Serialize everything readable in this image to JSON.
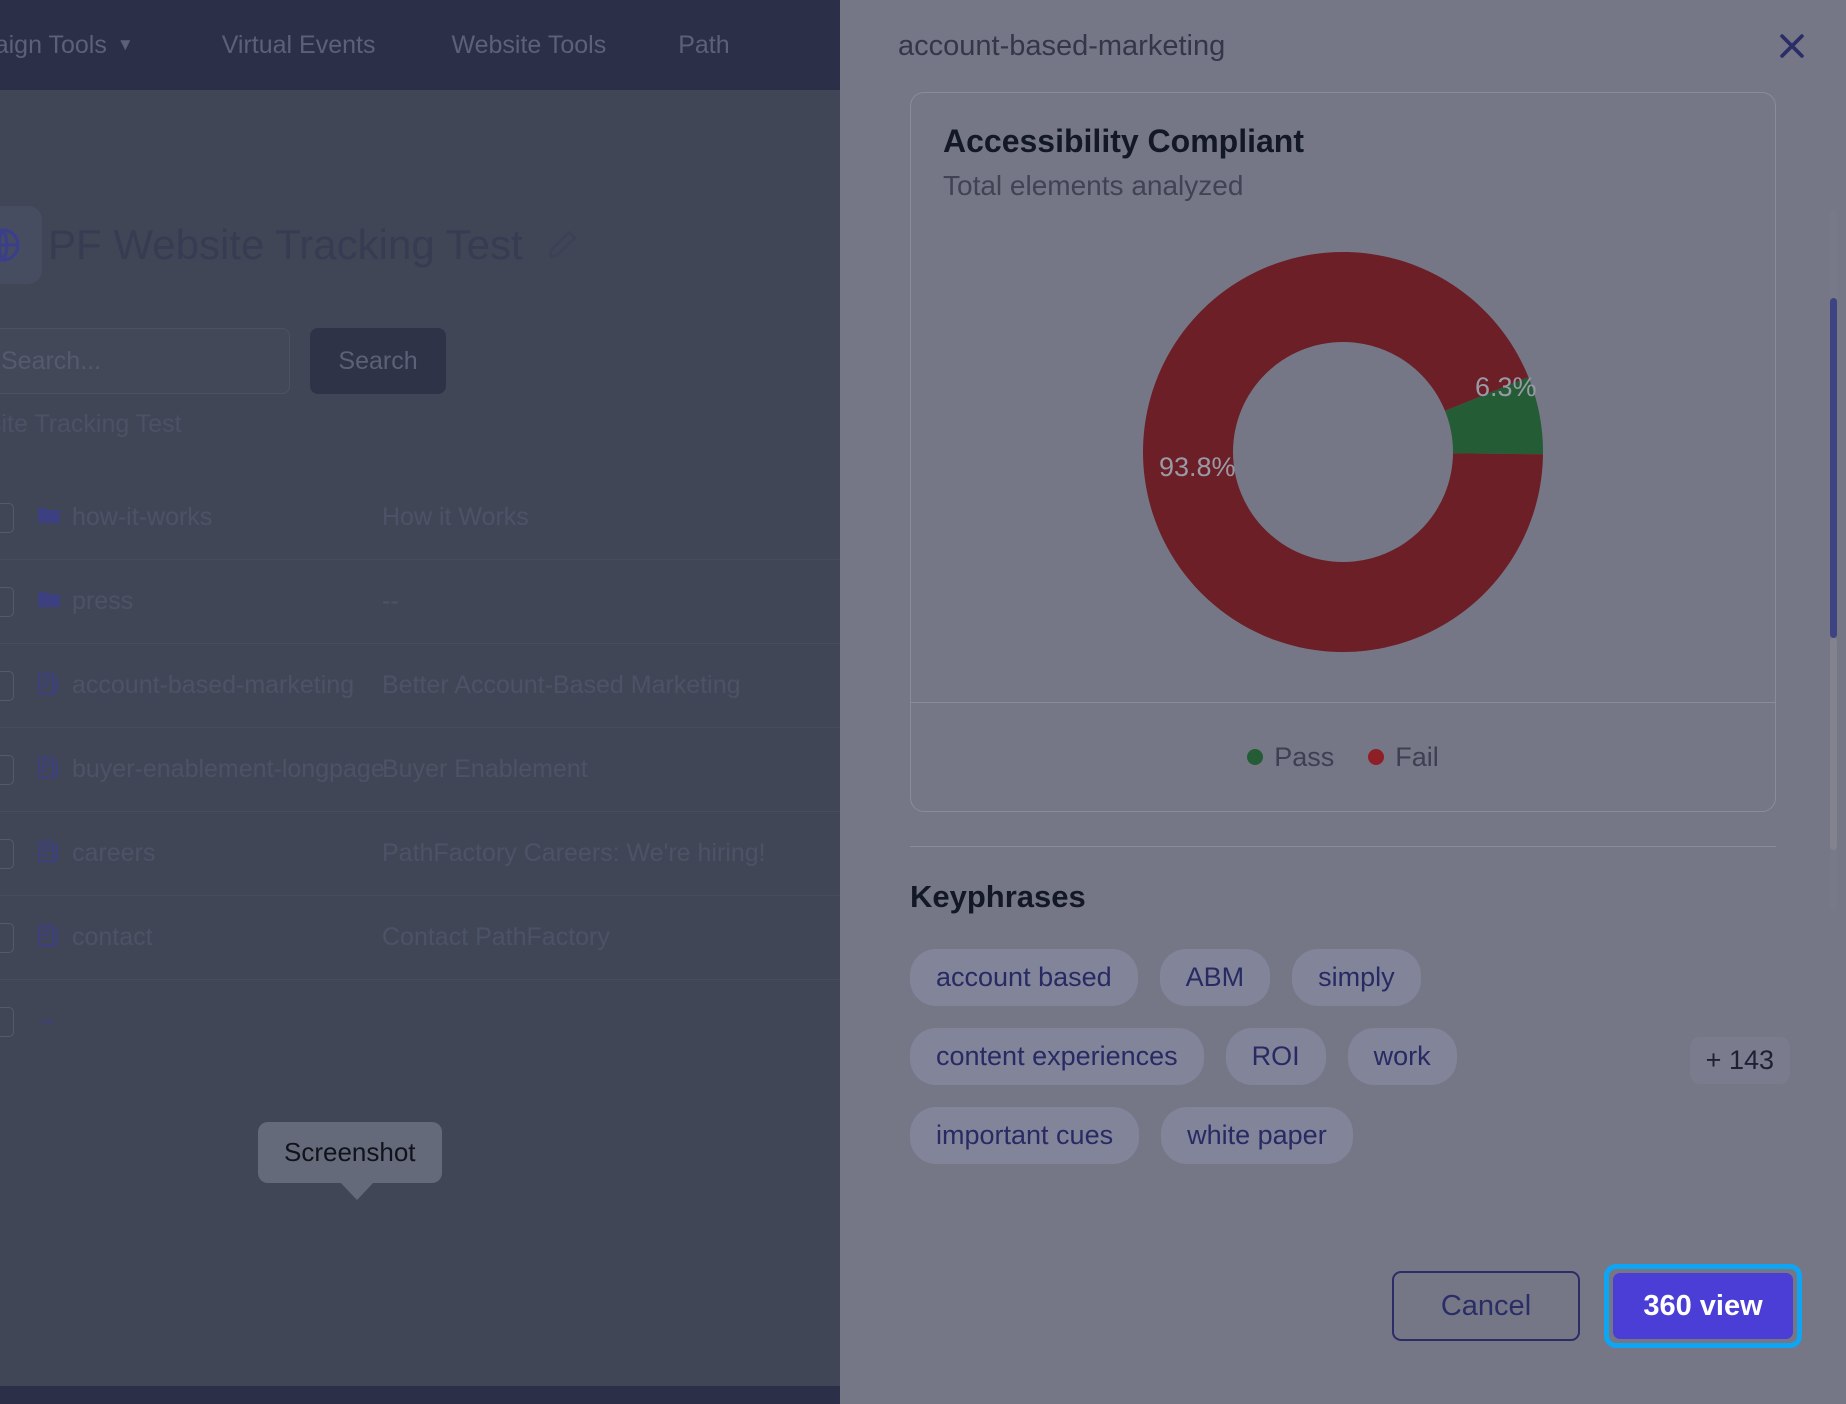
{
  "background_app": {
    "nav": {
      "items": [
        {
          "label": "mpaign Tools",
          "icon": "chevron-down-icon",
          "has_caret": true
        },
        {
          "label": "Virtual Events",
          "has_caret": false
        },
        {
          "label": "Website Tools",
          "has_caret": false
        },
        {
          "label": "Path",
          "has_caret": false
        }
      ]
    },
    "page_title": "PF Website Tracking Test",
    "edit_icon": "pencil-icon",
    "search": {
      "placeholder": "Search...",
      "value": "",
      "icon": "search-icon",
      "button_label": "Search"
    },
    "breadcrumb": "Website Tracking Test",
    "rows": [
      {
        "icon": "folder-icon",
        "name": "how-it-works",
        "title": "How it Works"
      },
      {
        "icon": "folder-icon",
        "name": "press",
        "title": "--"
      },
      {
        "icon": "document-icon",
        "name": "account-based-marketing",
        "title": "Better Account-Based Marketing"
      },
      {
        "icon": "document-icon",
        "name": "buyer-enablement-longpage",
        "title": "Buyer Enablement"
      },
      {
        "icon": "document-icon",
        "name": "careers",
        "title": "PathFactory Careers: We're hiring!"
      },
      {
        "icon": "document-icon",
        "name": "contact",
        "title": "Contact PathFactory"
      }
    ],
    "tooltip": "Screenshot"
  },
  "panel": {
    "title": "account-based-marketing",
    "close_icon": "close-icon",
    "chart_card": {
      "title": "Accessibility Compliant",
      "subtitle": "Total elements analyzed"
    },
    "keyphrases": {
      "heading": "Keyphrases",
      "chips": [
        "account based",
        "ABM",
        "simply",
        "content experiences",
        "ROI",
        "work",
        "important cues",
        "white paper"
      ],
      "more_label": "+ 143"
    },
    "footer": {
      "cancel_label": "Cancel",
      "primary_label": "360 view",
      "focus_ring_color": "#0ea5f5",
      "primary_color": "#4a3ed6"
    },
    "scrollbar": {
      "thumb_color": "#3e4482"
    }
  },
  "chart_data": {
    "type": "pie",
    "variant": "donut",
    "title": "Accessibility Compliant",
    "subtitle": "Total elements analyzed",
    "categories": [
      "Pass",
      "Fail"
    ],
    "values": [
      6.3,
      93.8
    ],
    "unit": "%",
    "data_labels": [
      "6.3%",
      "93.8%"
    ],
    "colors": [
      "#245c36",
      "#6c1f26"
    ],
    "label_color": "#9a9aa6",
    "legend": [
      "Pass",
      "Fail"
    ],
    "legend_position": "bottom",
    "start_angle_deg": 68,
    "inner_radius_ratio": 0.55,
    "grid": false
  }
}
